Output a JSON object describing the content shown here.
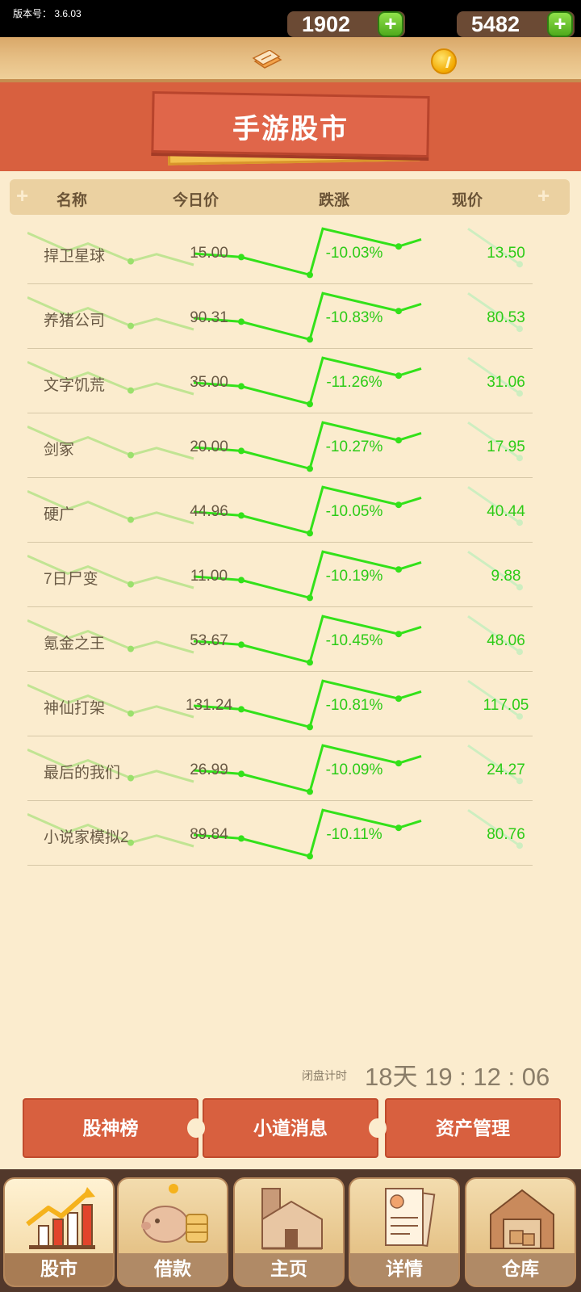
{
  "status_bar": {
    "version_text": "版本号： 3.6.03"
  },
  "resources": {
    "cash": "1902",
    "coins": "5482",
    "plus_symbol": "+"
  },
  "banner": {
    "title": "手游股市"
  },
  "table": {
    "columns": [
      "名称",
      "今日价",
      "跌涨",
      "现价"
    ],
    "rows": [
      {
        "name": "捍卫星球",
        "price": "15.00",
        "change": "-10.03%",
        "current": "13.50"
      },
      {
        "name": "养猪公司",
        "price": "90.31",
        "change": "-10.83%",
        "current": "80.53"
      },
      {
        "name": "文字饥荒",
        "price": "35.00",
        "change": "-11.26%",
        "current": "31.06"
      },
      {
        "name": "剑冢",
        "price": "20.00",
        "change": "-10.27%",
        "current": "17.95"
      },
      {
        "name": "硬广",
        "price": "44.96",
        "change": "-10.05%",
        "current": "40.44"
      },
      {
        "name": "7日尸变",
        "price": "11.00",
        "change": "-10.19%",
        "current": "9.88"
      },
      {
        "name": "氪金之王",
        "price": "53.67",
        "change": "-10.45%",
        "current": "48.06"
      },
      {
        "name": "神仙打架",
        "price": "131.24",
        "change": "-10.81%",
        "current": "117.05"
      },
      {
        "name": "最后的我们",
        "price": "26.99",
        "change": "-10.09%",
        "current": "24.27"
      },
      {
        "name": "小说家模拟2",
        "price": "89.84",
        "change": "-10.11%",
        "current": "80.76"
      }
    ]
  },
  "timer": {
    "label": "闭盘计时",
    "value": "18天 19 : 12 : 06"
  },
  "actions": {
    "ranking": "股神榜",
    "news": "小道消息",
    "assets": "资产管理"
  },
  "nav": [
    {
      "label": "股市"
    },
    {
      "label": "借款"
    },
    {
      "label": "主页"
    },
    {
      "label": "详情"
    },
    {
      "label": "仓库"
    }
  ],
  "colors": {
    "accent_red": "#d8603f",
    "gain_green": "#2ccb16",
    "background": "#fbecce"
  }
}
